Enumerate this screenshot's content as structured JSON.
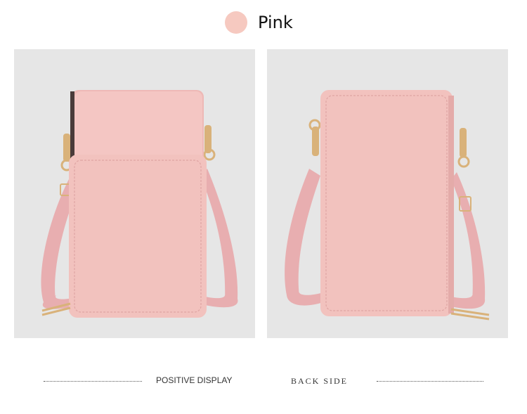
{
  "color_option": {
    "name": "Pink",
    "swatch_color": "#f6c9c0"
  },
  "product": {
    "bag_color": "#f2c2be",
    "hardware_color": "#d9b27a"
  },
  "captions": {
    "front": "POSITIVE DISPLAY",
    "back": "BACK SIDE"
  },
  "images": {
    "front_icon": "pink-phone-bag-front-photo",
    "back_icon": "pink-phone-bag-back-photo"
  }
}
